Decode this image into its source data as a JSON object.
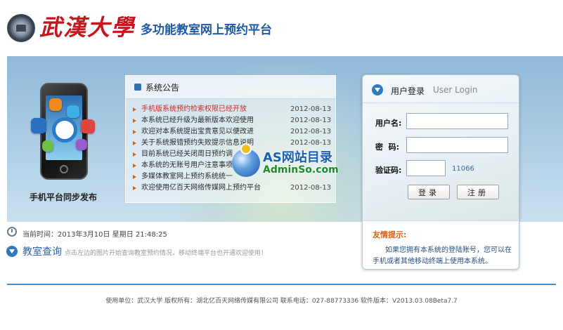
{
  "header": {
    "university_name": "武漢大學",
    "site_title": "多功能教室网上预约平台"
  },
  "banner": {
    "mobile_caption": "手机平台同步发布"
  },
  "notice": {
    "title": "系统公告",
    "items": [
      {
        "text": "手机版系统预约检索权限已经开放",
        "date": "2012-08-13",
        "hot": true
      },
      {
        "text": "本系统已经升级为最新版本欢迎使用",
        "date": "2012-08-13",
        "hot": false
      },
      {
        "text": "欢迎对本系统提出宝贵意见以便改进",
        "date": "2012-08-13",
        "hot": false
      },
      {
        "text": "关于系统报错预约失败提示信息说明",
        "date": "2012-08-13",
        "hot": false
      },
      {
        "text": "目前系统已经关闭周日预约调",
        "date": "",
        "hot": false
      },
      {
        "text": "本系统的无账号用户注意事项",
        "date": "",
        "hot": false
      },
      {
        "text": "多媒体教室网上预约系统统一",
        "date": "",
        "hot": false
      },
      {
        "text": "欢迎使用亿百天网络传媒网上预约平台",
        "date": "2012-08-13",
        "hot": false
      }
    ]
  },
  "watermark": {
    "line1": "AS网站目录",
    "line2": "AdminSo.com"
  },
  "login": {
    "title": "用户登录",
    "title_en": "User Login",
    "username_label": "用户名:",
    "password_label": "密  码:",
    "captcha_label": "验证码:",
    "username_value": "",
    "password_value": "",
    "captcha_value": "",
    "captcha_code": "11066",
    "login_button": "登录",
    "register_button": "注册",
    "tip_title": "友情提示:",
    "tip_line1": "如果您拥有本系统的登陆账号，您可以在",
    "tip_line2": "手机或者其他移动终端上使用本系统。"
  },
  "status": {
    "current_time": "当前时间：2013年3月10日 星期日 21:48:25"
  },
  "query": {
    "title": "教室查询",
    "description": "点击左边的图片开始查询教室预约情况，移动终端平台也开通欢迎使用！"
  },
  "footer": {
    "text": "使用单位：武汉大学   版权所有：湖北亿百天网络传媒有限公司   联系电话：027-88773336   软件版本：V2013.03.08Beta7.7"
  },
  "colors": {
    "brand_red": "#c4161c",
    "title_blue": "#1d5aa6",
    "hot_red": "#d2271c",
    "tip_orange": "#e06010"
  }
}
